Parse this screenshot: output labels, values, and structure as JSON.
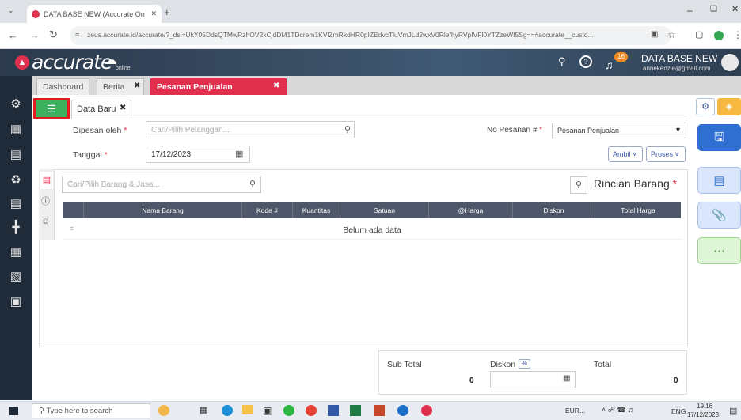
{
  "browser": {
    "tab_title": "DATA BASE NEW (Accurate On",
    "url": "zeus.accurate.id/accurate/?_dsi=UkY05DdsQTMwRzhOV2xCjdDM1TDcrem1KVlZmRkdHR0pIZEdvcTluVmJLd2wxV0RlefhyRVpIVFl0YTZzeWI5Sg==#accurate__custo..."
  },
  "app": {
    "logo": "accurate",
    "logo_sub": "online",
    "db_name": "DATA BASE NEW",
    "user_email": "annekenzie@gmail.com",
    "notif_count": "16",
    "accent": "#e0304e"
  },
  "module_tabs": [
    "Dashboard",
    "Berita",
    "Pesanan Penjualan"
  ],
  "form": {
    "doc_tab": "Data Baru",
    "ordered_by_label": "Dipesan oleh",
    "ordered_by_placeholder": "Cari/Pilih Pelanggan...",
    "order_no_label": "No Pesanan #",
    "order_no_value": "Pesanan Penjualan",
    "date_label": "Tanggal",
    "date_value": "17/12/2023",
    "take_btn": "Ambil",
    "process_btn": "Proses"
  },
  "items": {
    "search_placeholder": "Cari/Pilih Barang & Jasa...",
    "title": "Rincian Barang",
    "columns": [
      "Nama Barang",
      "Kode #",
      "Kuantitas",
      "Satuan",
      "@Harga",
      "Diskon",
      "Total Harga"
    ],
    "empty_text": "Belum ada data"
  },
  "totals": {
    "subtotal_label": "Sub Total",
    "subtotal_value": "0",
    "discount_label": "Diskon",
    "discount_unit": "%",
    "total_label": "Total",
    "total_value": "0"
  },
  "taskbar": {
    "search_placeholder": "Type here to search",
    "currency": "EUR...",
    "lang": "ENG",
    "time": "19:16",
    "date": "17/12/2023"
  }
}
